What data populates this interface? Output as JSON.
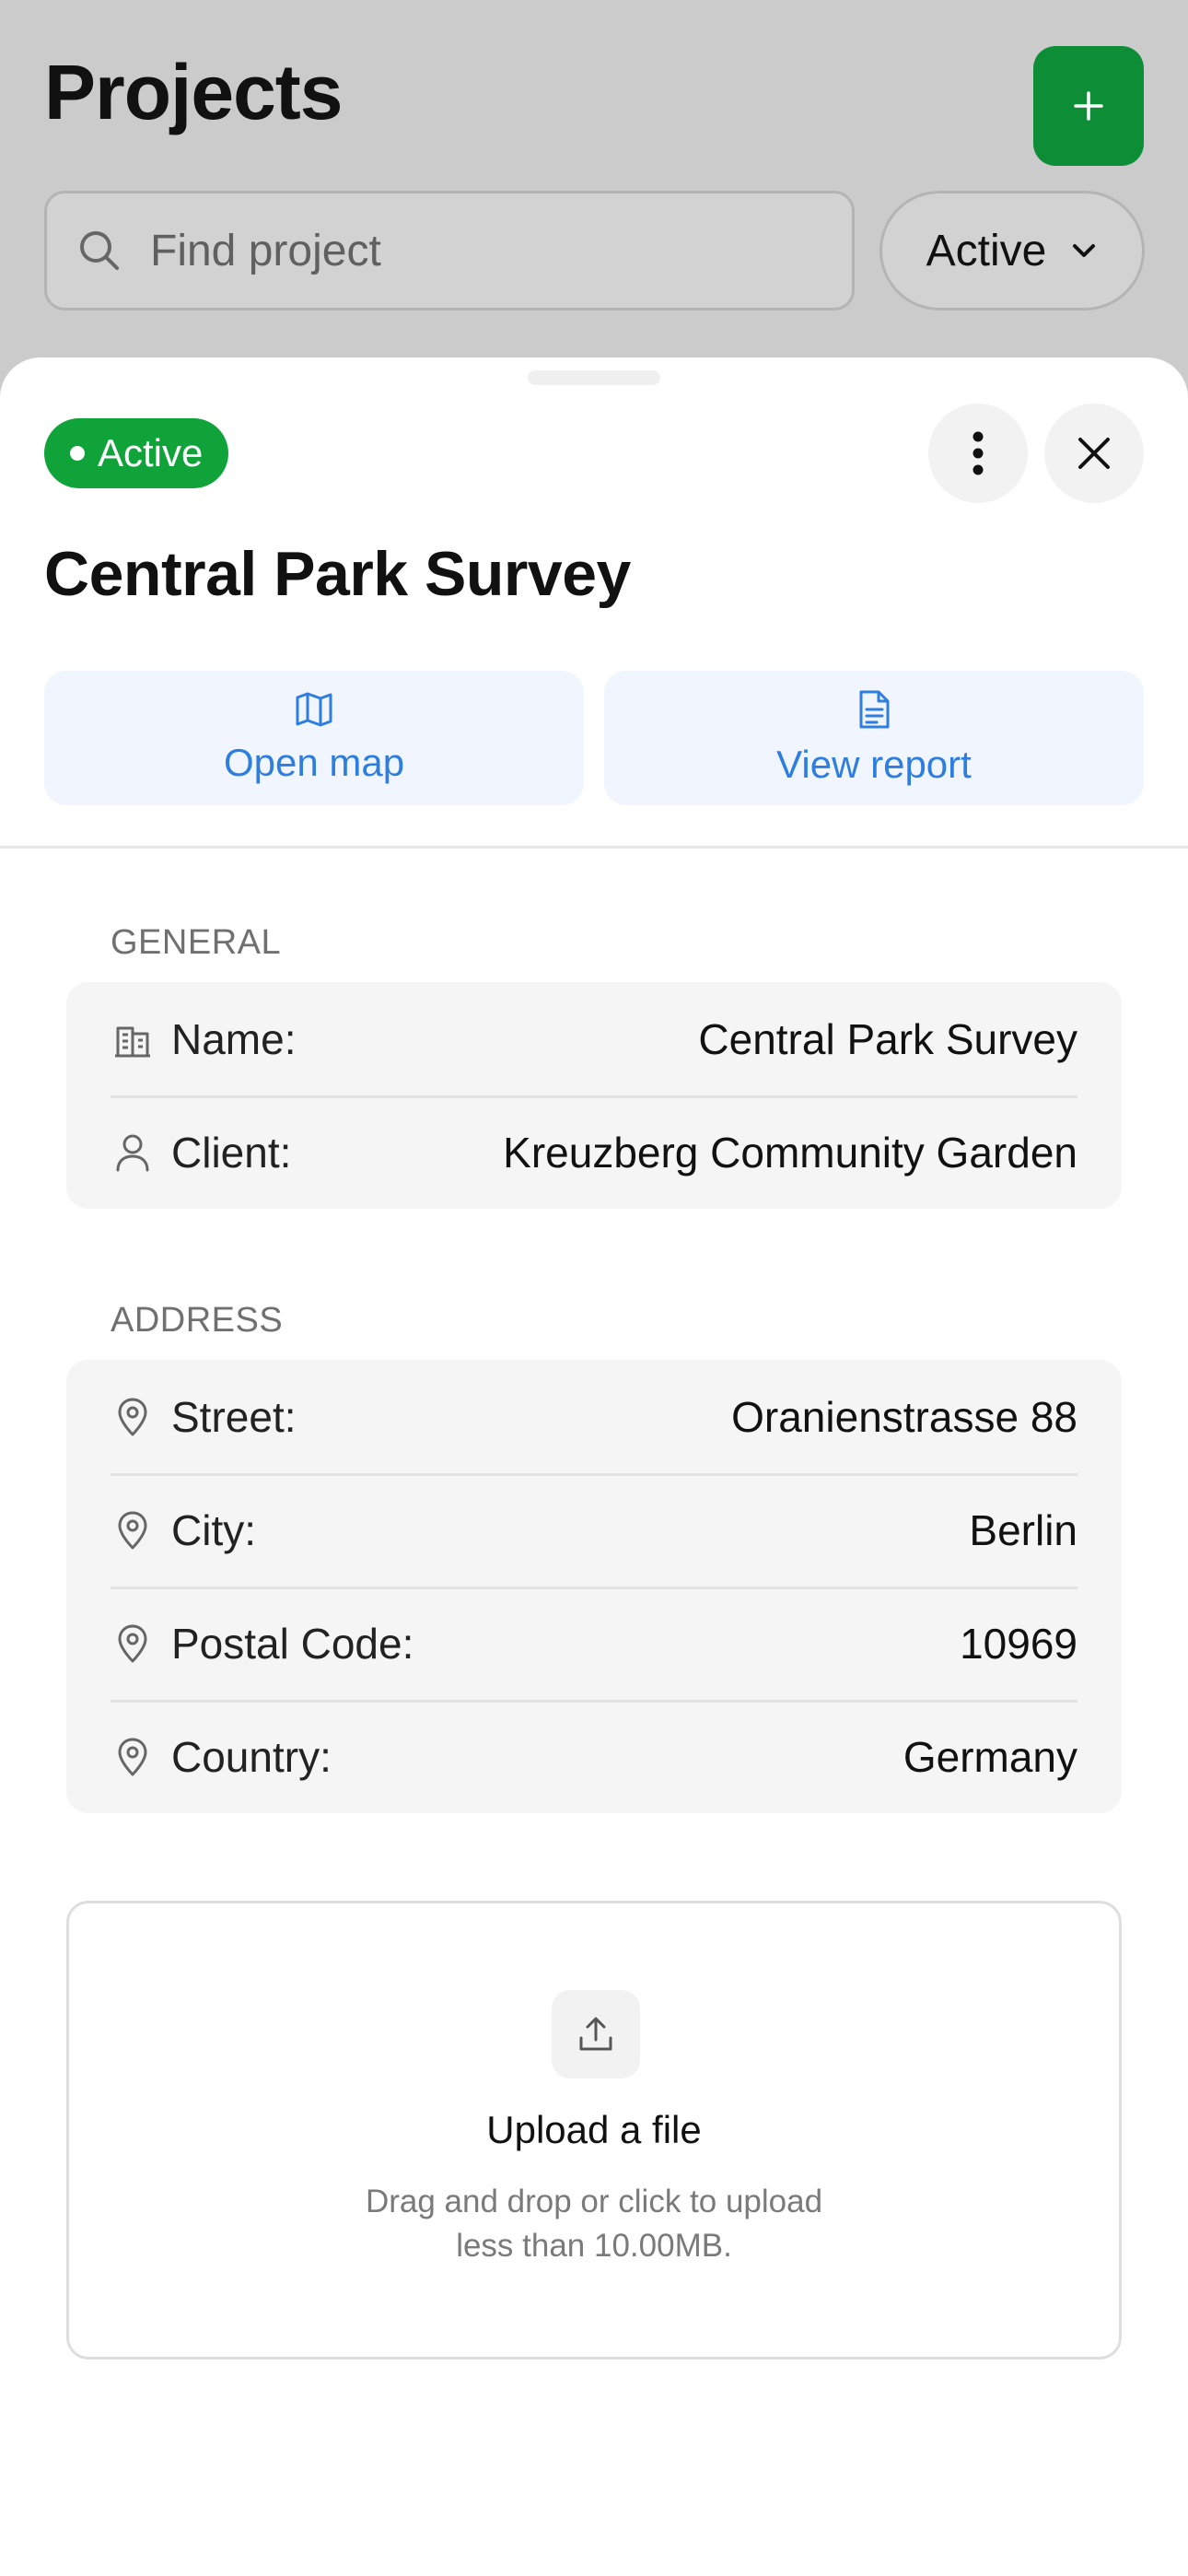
{
  "header": {
    "title": "Projects",
    "add_icon": "plus-icon"
  },
  "search": {
    "placeholder": "Find project",
    "value": ""
  },
  "filter": {
    "selected": "Active"
  },
  "sheet": {
    "status": "Active",
    "title": "Central Park Survey",
    "actions": [
      {
        "label": "Open map",
        "icon": "map-icon"
      },
      {
        "label": "View report",
        "icon": "document-icon"
      }
    ]
  },
  "general": {
    "label": "GENERAL",
    "rows": [
      {
        "label": "Name:",
        "value": "Central Park Survey",
        "icon": "building-icon"
      },
      {
        "label": "Client:",
        "value": "Kreuzberg Community Garden",
        "icon": "user-icon"
      }
    ]
  },
  "address": {
    "label": "ADDRESS",
    "rows": [
      {
        "label": "Street:",
        "value": "Oranienstrasse 88",
        "icon": "pin-icon"
      },
      {
        "label": "City:",
        "value": "Berlin",
        "icon": "pin-icon"
      },
      {
        "label": "Postal Code:",
        "value": "10969",
        "icon": "pin-icon"
      },
      {
        "label": "Country:",
        "value": "Germany",
        "icon": "pin-icon"
      }
    ]
  },
  "upload": {
    "title": "Upload a file",
    "hint_line1": "Drag and drop or click to upload",
    "hint_line2": "less than 10.00MB."
  },
  "colors": {
    "accent_green": "#0d8e36",
    "badge_green": "#0fa33a",
    "link_blue": "#2e7ee0"
  }
}
